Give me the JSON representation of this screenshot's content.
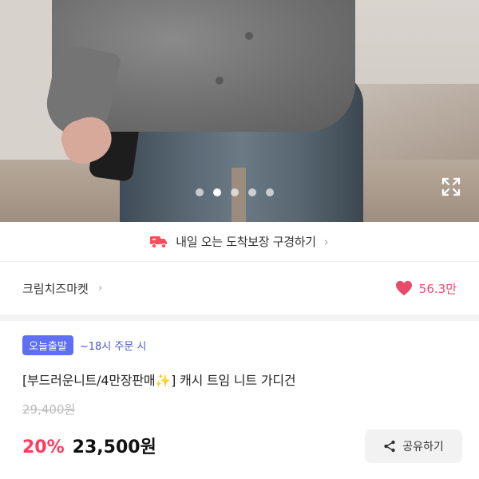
{
  "gallery": {
    "dots": [
      false,
      true,
      false,
      false,
      false
    ],
    "expand_icon": "expand-icon"
  },
  "delivery_banner": {
    "icon": "delivery-truck-icon",
    "text": "내일 오는 도착보장 구경하기",
    "chevron": "›"
  },
  "shop": {
    "name": "크림치즈마켓",
    "chevron": "›",
    "likes_icon": "heart-icon",
    "likes_count": "56.3만",
    "accent_color": "#e84a6a"
  },
  "product": {
    "badge": "오늘출발",
    "badge_note": "~18시 주문 시",
    "title": "[부드러운니트/4만장판매✨] 캐시 트임 니트 가디건",
    "original_price": "29,400원",
    "discount": "20%",
    "price": "23,500원",
    "discount_color": "#ff3b5c"
  },
  "share": {
    "label": "공유하기",
    "icon": "share-icon"
  }
}
